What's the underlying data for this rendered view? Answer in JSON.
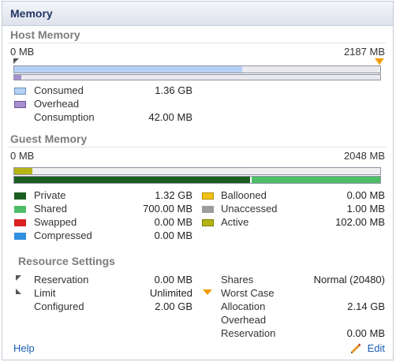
{
  "title": "Memory",
  "host": {
    "heading": "Host Memory",
    "scale_min": "0 MB",
    "scale_max": "2187 MB",
    "consumed_fraction": 0.622,
    "overhead_fraction": 0.02,
    "legend": [
      {
        "label": "Consumed",
        "value": "1.36 GB",
        "color": "#b4d1f4"
      },
      {
        "label": "Overhead",
        "value": "",
        "color": "#a88fcf"
      },
      {
        "label": "Consumption",
        "value": "42.00 MB",
        "color": ""
      }
    ]
  },
  "guest": {
    "heading": "Guest Memory",
    "scale_min": "0 MB",
    "scale_max": "2048 MB",
    "active_fraction": 0.05,
    "private_fraction": 0.645,
    "legend_left": [
      {
        "label": "Private",
        "value": "1.32 GB",
        "color": "#1b5e20"
      },
      {
        "label": "Shared",
        "value": "700.00 MB",
        "color": "#4ebd68"
      },
      {
        "label": "Swapped",
        "value": "0.00 MB",
        "color": "#d92121"
      },
      {
        "label": "Compressed",
        "value": "0.00 MB",
        "color": "#2f8fe0"
      }
    ],
    "legend_right": [
      {
        "label": "Ballooned",
        "value": "0.00 MB",
        "color": "#f2c314"
      },
      {
        "label": "Unaccessed",
        "value": "1.00 MB",
        "color": "#9c9c9c"
      },
      {
        "label": "Active",
        "value": "102.00 MB",
        "color": "#b5b516"
      }
    ]
  },
  "resource": {
    "heading": "Resource Settings",
    "left": [
      {
        "label": "Reservation",
        "value": "0.00 MB"
      },
      {
        "label": "Limit",
        "value": "Unlimited"
      },
      {
        "label": "Configured",
        "value": "2.00 GB"
      }
    ],
    "shares_label": "Shares",
    "shares_value": "Normal (20480)",
    "worst_case_label": "Worst Case",
    "allocation_label": "Allocation",
    "allocation_value": "2.14 GB",
    "overhead_label": "Overhead",
    "reservation_label": "Reservation",
    "reservation_value": "0.00 MB"
  },
  "footer": {
    "help": "Help",
    "edit": "Edit"
  },
  "colors": {
    "title": "#213464",
    "link": "#1a5fb4",
    "marker": "#f29b00"
  }
}
